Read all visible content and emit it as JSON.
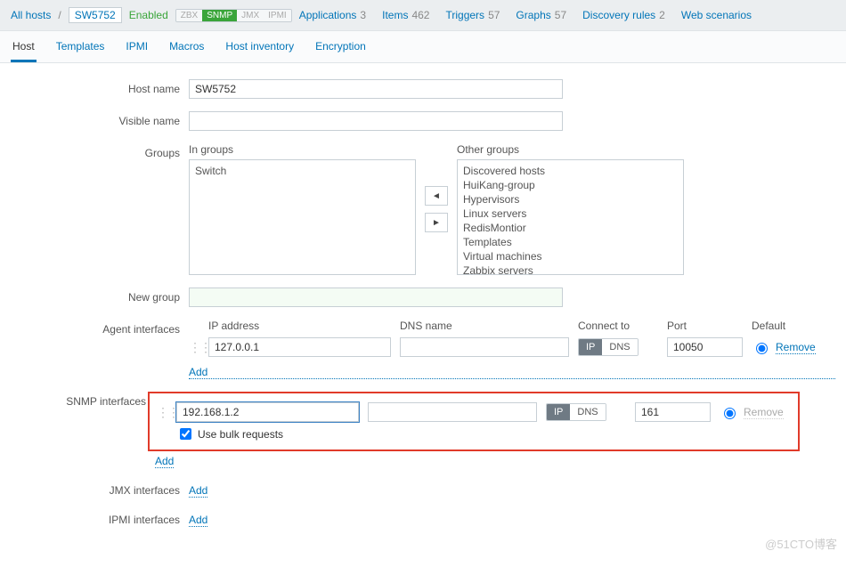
{
  "breadcrumb": {
    "all_hosts": "All hosts",
    "host": "SW5752"
  },
  "status": "Enabled",
  "proto": {
    "zbx": "ZBX",
    "snmp": "SNMP",
    "jmx": "JMX",
    "ipmi": "IPMI"
  },
  "toplinks": {
    "apps": {
      "label": "Applications",
      "count": "3"
    },
    "items": {
      "label": "Items",
      "count": "462"
    },
    "triggers": {
      "label": "Triggers",
      "count": "57"
    },
    "graphs": {
      "label": "Graphs",
      "count": "57"
    },
    "discovery": {
      "label": "Discovery rules",
      "count": "2"
    },
    "web": {
      "label": "Web scenarios",
      "count": ""
    }
  },
  "tabs": {
    "host": "Host",
    "templates": "Templates",
    "ipmi": "IPMI",
    "macros": "Macros",
    "hostinv": "Host inventory",
    "encryption": "Encryption"
  },
  "labels": {
    "hostname": "Host name",
    "visiblename": "Visible name",
    "groups": "Groups",
    "ingroups": "In groups",
    "othergroups": "Other groups",
    "newgroup": "New group",
    "agent": "Agent interfaces",
    "snmp": "SNMP interfaces",
    "jmx": "JMX interfaces",
    "ipmi_if": "IPMI interfaces",
    "ip": "IP address",
    "dns": "DNS name",
    "connect": "Connect to",
    "port": "Port",
    "default": "Default",
    "add": "Add",
    "remove": "Remove",
    "bulk": "Use bulk requests",
    "ip_btn": "IP",
    "dns_btn": "DNS"
  },
  "values": {
    "hostname": "SW5752",
    "visiblename": "",
    "newgroup": ""
  },
  "groups": {
    "in": [
      "Switch"
    ],
    "other": [
      "Discovered hosts",
      "HuiKang-group",
      "Hypervisors",
      "Linux servers",
      "RedisMontior",
      "Templates",
      "Virtual machines",
      "Zabbix servers"
    ]
  },
  "agent": {
    "ip": "127.0.0.1",
    "dns": "",
    "port": "10050",
    "connect": "IP",
    "default": true
  },
  "snmp": {
    "ip": "192.168.1.2",
    "dns": "",
    "port": "161",
    "connect": "IP",
    "default": true,
    "bulk": true
  },
  "watermark": "@51CTO博客"
}
